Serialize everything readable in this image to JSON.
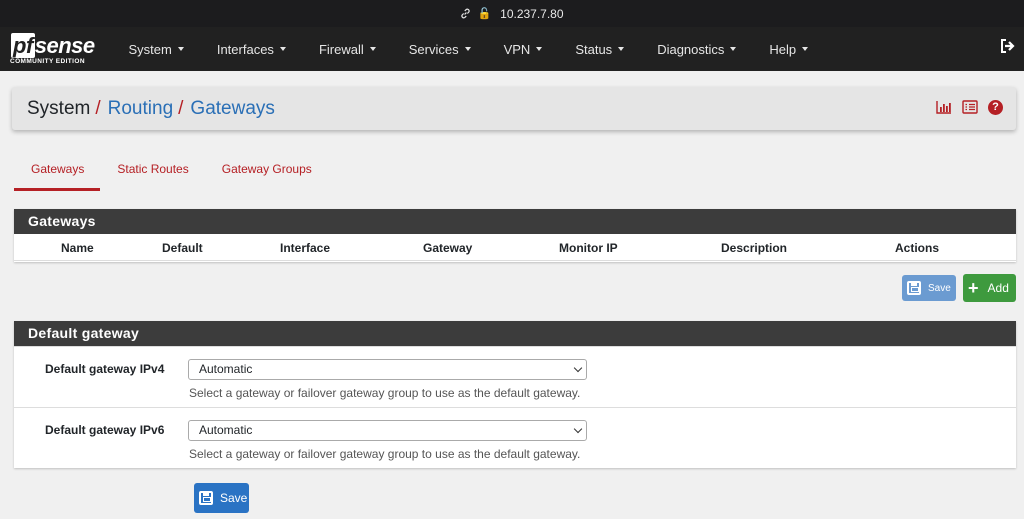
{
  "browser": {
    "address": "10.237.7.80"
  },
  "logo": {
    "brand_pf": "pf",
    "brand_sense": "sense",
    "edition": "COMMUNITY EDITION"
  },
  "nav": {
    "items": [
      {
        "label": "System"
      },
      {
        "label": "Interfaces"
      },
      {
        "label": "Firewall"
      },
      {
        "label": "Services"
      },
      {
        "label": "VPN"
      },
      {
        "label": "Status"
      },
      {
        "label": "Diagnostics"
      },
      {
        "label": "Help"
      }
    ]
  },
  "breadcrumb": {
    "root": "System",
    "sep": "/",
    "level1": "Routing",
    "level2": "Gateways"
  },
  "tabs": [
    {
      "label": "Gateways",
      "active": true
    },
    {
      "label": "Static Routes",
      "active": false
    },
    {
      "label": "Gateway Groups",
      "active": false
    }
  ],
  "gateways_panel": {
    "title": "Gateways",
    "columns": [
      "Name",
      "Default",
      "Interface",
      "Gateway",
      "Monitor IP",
      "Description",
      "Actions"
    ]
  },
  "buttons": {
    "save": "Save",
    "add": "Add"
  },
  "default_gateway_panel": {
    "title": "Default gateway",
    "ipv4": {
      "label": "Default gateway IPv4",
      "value": "Automatic",
      "help": "Select a gateway or failover gateway group to use as the default gateway."
    },
    "ipv6": {
      "label": "Default gateway IPv6",
      "value": "Automatic",
      "help": "Select a gateway or failover gateway group to use as the default gateway."
    }
  },
  "colors": {
    "brand_red": "#b52025",
    "link_blue": "#2a6fb6",
    "nav_bg": "#212121",
    "add_green": "#3e9a3e"
  }
}
